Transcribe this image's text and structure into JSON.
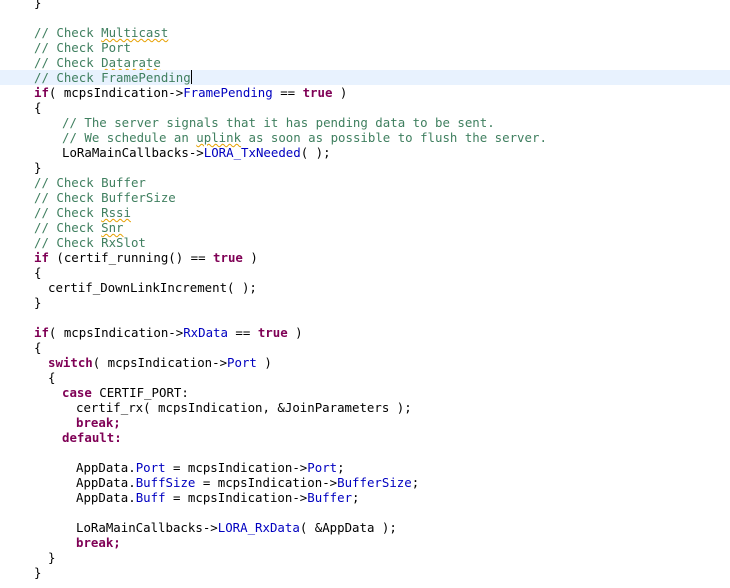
{
  "code": {
    "lines": [
      {
        "t": "}"
      },
      {
        "t": ""
      },
      {
        "t": "// Check Multicast"
      },
      {
        "t": "// Check Port"
      },
      {
        "t": "// Check Datarate"
      },
      {
        "t": "// Check FramePending"
      },
      {
        "t": "if( mcpsIndication->FramePending == true )"
      },
      {
        "t": "{"
      },
      {
        "t": "// The server signals that it has pending data to be sent."
      },
      {
        "t": "// We schedule an uplink as soon as possible to flush the server."
      },
      {
        "t": "LoRaMainCallbacks->LORA_TxNeeded( );"
      },
      {
        "t": "}"
      },
      {
        "t": "// Check Buffer"
      },
      {
        "t": "// Check BufferSize"
      },
      {
        "t": "// Check Rssi"
      },
      {
        "t": "// Check Snr"
      },
      {
        "t": "// Check RxSlot"
      },
      {
        "t": "if (certif_running() == true )"
      },
      {
        "t": "{"
      },
      {
        "t": "certif_DownLinkIncrement( );"
      },
      {
        "t": "}"
      },
      {
        "t": ""
      },
      {
        "t": "if( mcpsIndication->RxData == true )"
      },
      {
        "t": "{"
      },
      {
        "t": "switch( mcpsIndication->Port )"
      },
      {
        "t": "{"
      },
      {
        "t": "case CERTIF_PORT:"
      },
      {
        "t": "certif_rx( mcpsIndication, &JoinParameters );"
      },
      {
        "t": "break;"
      },
      {
        "t": "default:"
      },
      {
        "t": ""
      },
      {
        "t": "AppData.Port = mcpsIndication->Port;"
      },
      {
        "t": "AppData.BuffSize = mcpsIndication->BufferSize;"
      },
      {
        "t": "AppData.Buff = mcpsIndication->Buffer;"
      },
      {
        "t": ""
      },
      {
        "t": "LoRaMainCallbacks->LORA_RxData( &AppData );"
      },
      {
        "t": "break;"
      },
      {
        "t": "}"
      },
      {
        "t": "}"
      }
    ]
  }
}
